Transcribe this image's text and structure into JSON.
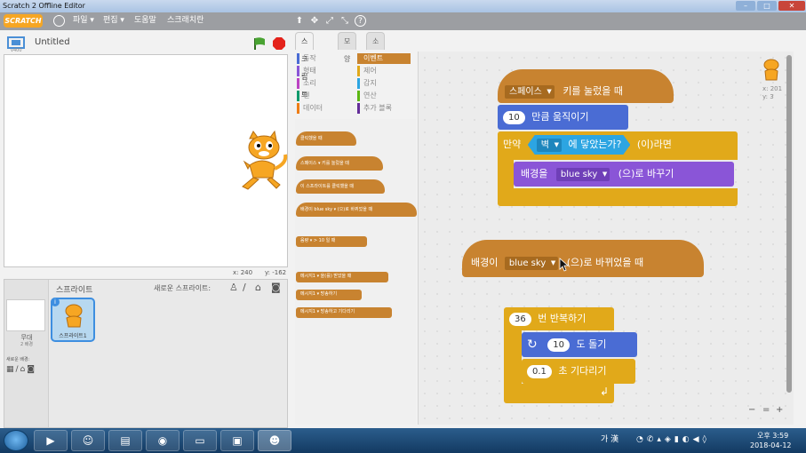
{
  "window": {
    "title": "Scratch 2 Offline Editor",
    "min": "–",
    "max": "□",
    "close": "✕"
  },
  "menu": {
    "logo": "SCRATCH",
    "items": [
      "파일 ▾",
      "편집 ▾",
      "도움말",
      "스크래치란"
    ],
    "tools": [
      "duplicate-icon",
      "delete-icon",
      "grow-icon",
      "shrink-icon",
      "help-icon"
    ],
    "tool_glyphs": [
      "⬆",
      "✥",
      "⤢",
      "⤡",
      "?"
    ]
  },
  "stage": {
    "title": "Untitled",
    "version": "v400",
    "coord_x": "x: 240",
    "coord_y": "y: -162"
  },
  "sprites": {
    "header": "스프라이트",
    "new_sprite": "새로운 스프라이트:",
    "stage_label": "무대",
    "stage_count": "2 배경",
    "new_backdrop": "새로운 배경:",
    "sprite_name": "스프라이트1"
  },
  "tabs": [
    "스크립트",
    "모양",
    "소리"
  ],
  "categories": [
    {
      "label": "동작",
      "color": "#4a6cd4"
    },
    {
      "label": "이벤트",
      "color": "#c88330",
      "selected": true
    },
    {
      "label": "형태",
      "color": "#8a55d7"
    },
    {
      "label": "제어",
      "color": "#e1a91a"
    },
    {
      "label": "소리",
      "color": "#bb42c3"
    },
    {
      "label": "감지",
      "color": "#2ca5e2"
    },
    {
      "label": "펜",
      "color": "#0e9a6c"
    },
    {
      "label": "연산",
      "color": "#5cb712"
    },
    {
      "label": "데이터",
      "color": "#ee7d16"
    },
    {
      "label": "추가 블록",
      "color": "#632d99"
    }
  ],
  "palette": [
    "클릭했을 때",
    "스페이스 ▾ 키를 눌렀을 때",
    "이 스프라이트를 클릭했을 때",
    "배경이 blue sky ▾ (으)로 바뀌었을 때",
    "음량 ▾ > 10 일 때",
    "메시지1 ▾ 을(를) 받았을 때",
    "메시지1 ▾ 방송하기",
    "메시지1 ▾ 방송하고 기다리기"
  ],
  "script1": {
    "hat_key": "스페이스",
    "hat_text": "키를 눌렀을 때",
    "move_num": "10",
    "move_text": "만큼 움직이기",
    "if_text": "만약",
    "sense_dd": "벽",
    "sense_text": "에 닿았는가?",
    "if_suffix": "(이)라면",
    "look_text": "배경을",
    "look_dd": "blue sky",
    "look_suffix": "(으)로 바꾸기"
  },
  "script2": {
    "hat_prefix": "배경이",
    "hat_dd": "blue sky",
    "hat_suffix": "(으)로 바뀌었을 때"
  },
  "script3": {
    "repeat_num": "36",
    "repeat_text": "번 반복하기",
    "turn_num": "10",
    "turn_text": "도 돌기",
    "wait_num": "0.1",
    "wait_text": "초 기다리기"
  },
  "sprite_info": {
    "x": "x: 201",
    "y": "y: 3"
  },
  "zoom": [
    "−",
    "=",
    "+"
  ],
  "taskbar": {
    "apps": [
      "media-player-icon",
      "user-icon",
      "file-explorer-icon",
      "chrome-icon",
      "notepad-icon",
      "network-icon",
      "scratch-icon"
    ],
    "ime": "가 漢",
    "time": "오후 3:59",
    "date": "2018-04-12"
  },
  "colors": {
    "event": "#c88330",
    "motion": "#4a6cd4",
    "control": "#e1a91a",
    "looks": "#8a55d7",
    "sensing": "#2ca5e2"
  }
}
